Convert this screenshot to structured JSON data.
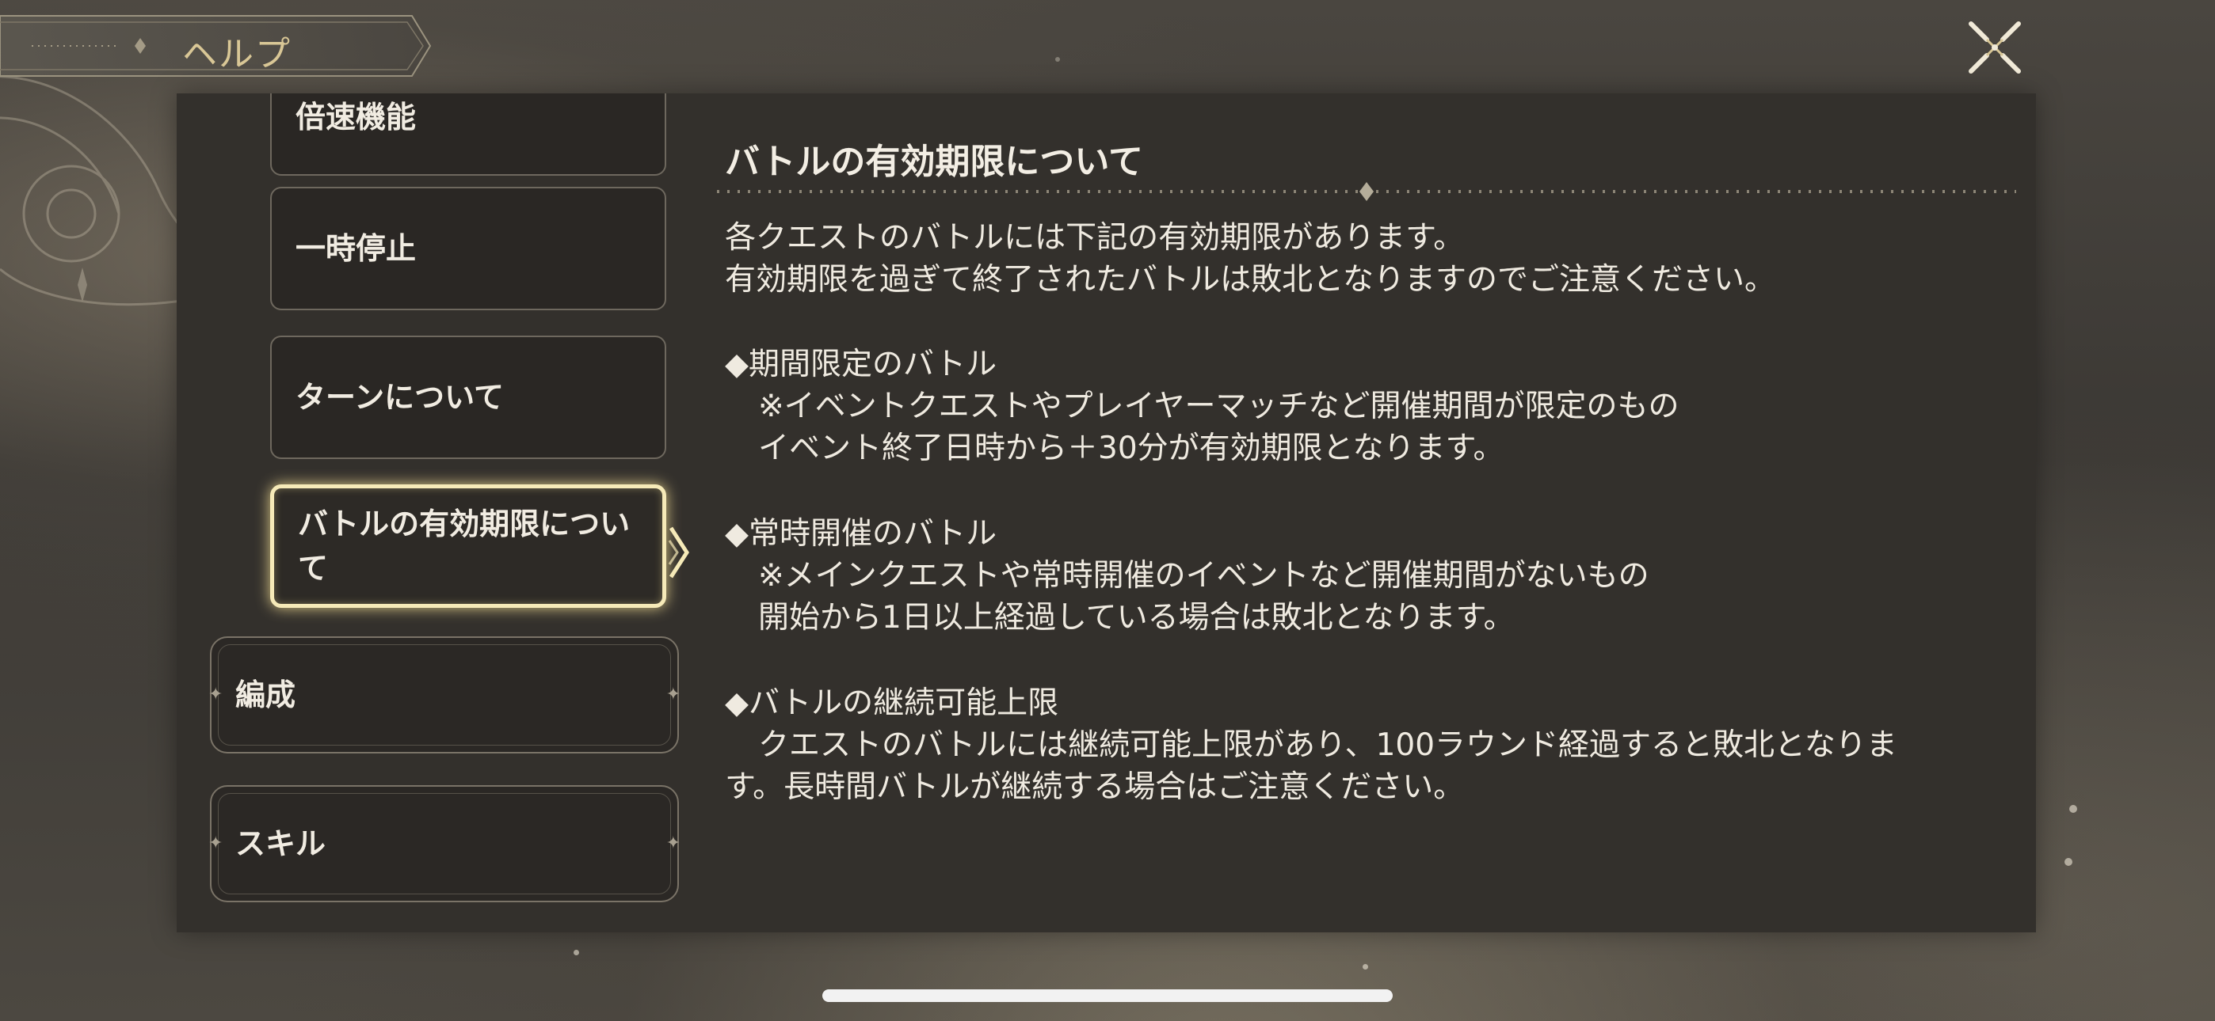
{
  "header": {
    "title": "ヘルプ",
    "close_icon": "close-x-icon"
  },
  "menu": {
    "items": [
      {
        "label": "倍速機能",
        "state": "partially-scrolled"
      },
      {
        "label": "一時停止"
      },
      {
        "label": "ターンについて"
      },
      {
        "label_line1": "バトルの有効期限につい",
        "label_line2": "て",
        "state": "selected"
      }
    ],
    "categories": [
      {
        "label": "編成"
      },
      {
        "label": "スキル"
      }
    ]
  },
  "content": {
    "title": "バトルの有効期限について",
    "intro_1": "各クエストのバトルには下記の有効期限があります。",
    "intro_2": "有効期限を過ぎて終了されたバトルは敗北となりますのでご注意ください。",
    "section1": {
      "heading": "◆期間限定のバトル",
      "line1": "※イベントクエストやプレイヤーマッチなど開催期間が限定のもの",
      "line2": "イベント終了日時から＋30分が有効期限となります。"
    },
    "section2": {
      "heading": "◆常時開催のバトル",
      "line1": "※メインクエストや常時開催のイベントなど開催期間がないもの",
      "line2": "開始から1日以上経過している場合は敗北となります。"
    },
    "section3": {
      "heading": "◆バトルの継続可能上限",
      "line1": "クエストのバトルには継続可能上限があり、100ラウンド経過すると敗北となりま",
      "line2": "す。長時間バトルが継続する場合はご注意ください。"
    }
  },
  "colors": {
    "panel": "#33302c",
    "header_text": "#d9c796",
    "active_glow": "#f6eab8",
    "body_text": "#efeae0"
  }
}
